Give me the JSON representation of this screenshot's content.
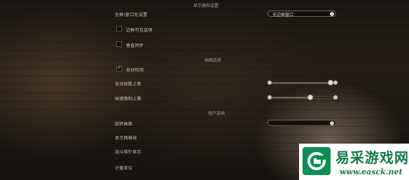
{
  "sections": {
    "display": "显示器和设置",
    "engine": "画面选项",
    "user": "用户选项"
  },
  "settings": {
    "full_screen": {
      "label": "全屏/窗口化设置",
      "value": "无边框窗口"
    },
    "pause_when_unfocused": {
      "label": "边框可见选项",
      "checked": false
    },
    "vsync": {
      "label": "垂直同步",
      "checked": false
    },
    "auto_detect": {
      "label": "自动检测",
      "checked": true
    },
    "frame_limit": {
      "label": "自动帧数上限",
      "fraction": 0.95
    },
    "fps_limit": {
      "label": "帧速限制上限",
      "fraction": 0.63
    },
    "language": {
      "label": "旋转画面",
      "value": ""
    },
    "row_a": {
      "label": "显示网格线",
      "text": ""
    },
    "row_b": {
      "label": "战斗指针显示",
      "text": ""
    },
    "row_c": {
      "label": "计量单位",
      "text": ""
    }
  },
  "watermark": {
    "chinese": "易采游戏网",
    "url": "www.easck.net"
  }
}
